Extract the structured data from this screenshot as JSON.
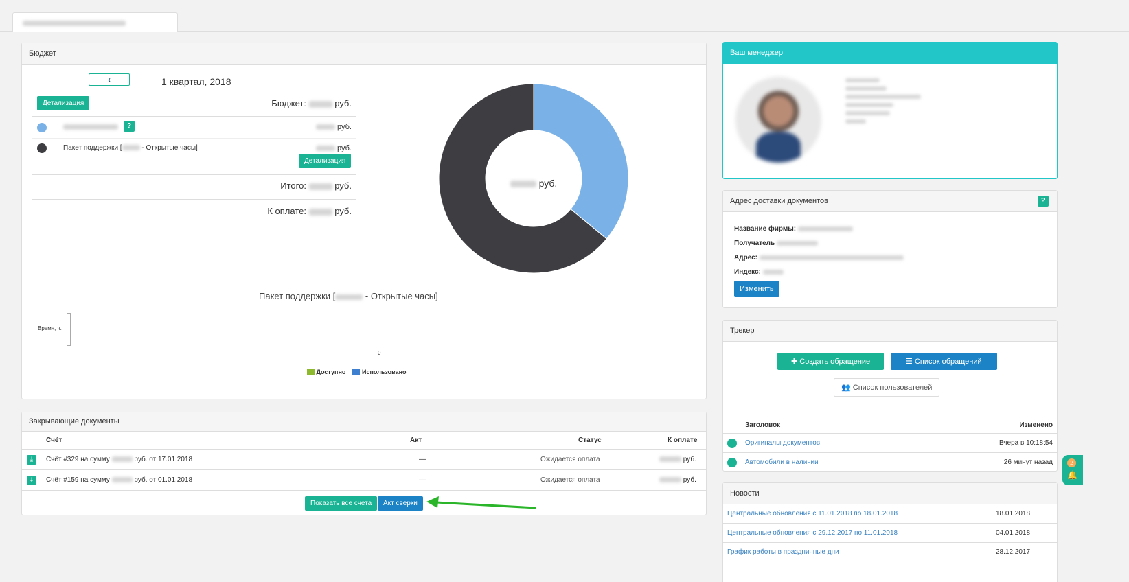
{
  "top_tab": {
    "label": "(blurred)"
  },
  "budget": {
    "title": "Бюджет",
    "period": "1 квартал, 2018",
    "details_label": "Детализация",
    "budget_label": "Бюджет:",
    "currency": "руб.",
    "rows": [
      {
        "label": "",
        "color": "#7ab2e8",
        "amount_suffix": "руб."
      },
      {
        "label_prefix": "Пакет поддержки [",
        "label_mid": "",
        "label_suffix": " - Открытые часы]",
        "color": "#3e3e42",
        "amount_suffix": "руб.",
        "details_label": "Детализация"
      }
    ],
    "total_label": "Итого:",
    "to_pay_label": "К оплате:",
    "donut_center_suffix": "руб.",
    "donut_colors": [
      "#7ab2e8",
      "#3e3e42"
    ]
  },
  "chart_data": {
    "type": "pie",
    "title": "",
    "labels": [
      "",
      "Пакет поддержки [ - Открытые часы]"
    ],
    "values": [
      0.36,
      0.64
    ],
    "colors": [
      "#7ab2e8",
      "#3e3e42"
    ],
    "donut": true
  },
  "package_chart": {
    "title_prefix": "Пакет поддержки [",
    "title_suffix": " - Открытые часы]",
    "ylabel": "Время, ч.",
    "zero_label": "0",
    "legend": [
      {
        "label": "Доступно",
        "color": "#8cb92d"
      },
      {
        "label": "Использовано",
        "color": "#3e7fd0"
      }
    ]
  },
  "docs": {
    "title": "Закрывающие документы",
    "columns": [
      "Счёт",
      "Акт",
      "Статус",
      "К оплате"
    ],
    "rows": [
      {
        "invoice_prefix": "Счёт #329 на сумму ",
        "invoice_suffix": " руб. от 17.01.2018",
        "act": "—",
        "status": "Ожидается оплата",
        "pay_suffix": "руб."
      },
      {
        "invoice_prefix": "Счёт #159 на сумму ",
        "invoice_suffix": " руб. от 01.01.2018",
        "act": "—",
        "status": "Ожидается оплата",
        "pay_suffix": "руб."
      }
    ],
    "show_all_label": "Показать все счета",
    "reconcile_label": "Акт сверки"
  },
  "manager": {
    "title": "Ваш менеджер"
  },
  "address": {
    "title": "Адрес доставки документов",
    "help": "?",
    "company_label": "Название фирмы:",
    "recipient_label": "Получатель",
    "address_label": "Адрес:",
    "index_label": "Индекс:",
    "change_label": "Изменить"
  },
  "tracker": {
    "title": "Трекер",
    "create_label": "Создать обращение",
    "list_label": "Список обращений",
    "users_label": "Список пользователей",
    "col_title": "Заголовок",
    "col_changed": "Изменено",
    "rows": [
      {
        "title": "Оригиналы документов",
        "changed": "Вчера в 10:18:54"
      },
      {
        "title": "Автомобили в наличии",
        "changed": "26 минут назад"
      }
    ]
  },
  "news": {
    "title": "Новости",
    "rows": [
      {
        "title": "Центральные обновления с 11.01.2018 по 18.01.2018",
        "date": "18.01.2018"
      },
      {
        "title": "Центральные обновления с 29.12.2017 по 11.01.2018",
        "date": "04.01.2018"
      },
      {
        "title": "График работы в праздничные дни",
        "date": "28.12.2017"
      }
    ]
  },
  "notification": {
    "count": "2"
  }
}
